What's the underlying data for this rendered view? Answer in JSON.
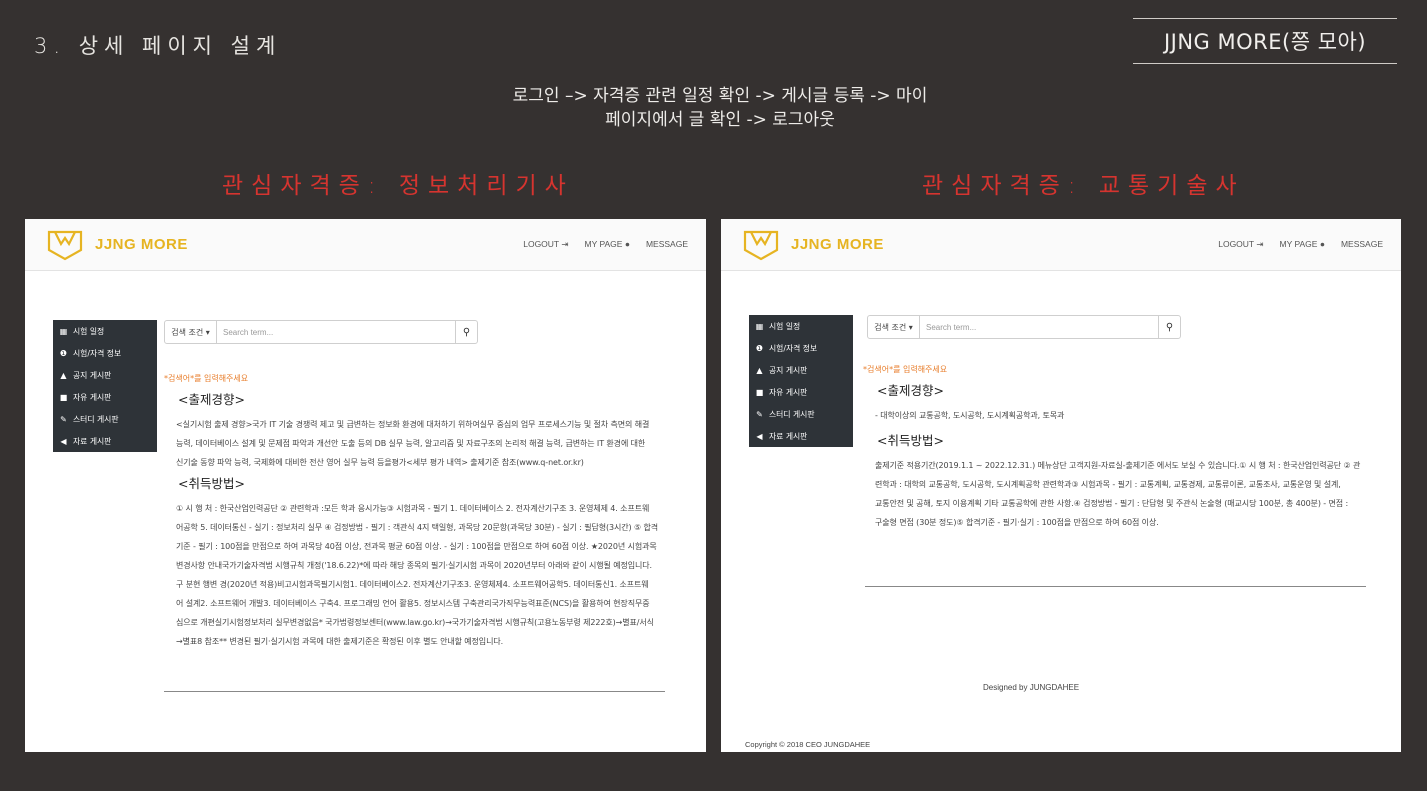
{
  "slide": {
    "title": "3. 상세 페이지 설계",
    "brand": "JJNG MORE(쯩 모아)",
    "flow_line1": "로그인 –> 자격증 관련 일정 확인 -> 게시글 등록 -> 마이",
    "flow_line2": "페이지에서 글 확인 -> 로그아웃",
    "interest_left": "관심자격증: 정보처리기사",
    "interest_right": "관심자격증: 교통기술사",
    "accent_color": "#d6342f"
  },
  "app": {
    "logo_text": "JJNG MORE",
    "nav": {
      "logout": "LOGOUT",
      "mypage": "MY PAGE",
      "message": "MESSAGE"
    },
    "sidebar": [
      {
        "icon": "calendar-icon",
        "label": "시험 일정"
      },
      {
        "icon": "info-icon",
        "label": "시험/자격 정보"
      },
      {
        "icon": "bell-icon",
        "label": "공지 게시판"
      },
      {
        "icon": "comment-icon",
        "label": "자유 게시판"
      },
      {
        "icon": "pencil-icon",
        "label": "스터디 게시판"
      },
      {
        "icon": "share-icon",
        "label": "자료 게시판"
      }
    ],
    "search": {
      "condition": "검색 조건 ▾",
      "placeholder": "Search term..."
    },
    "hint": "*검색어*를 입력해주세요",
    "section1": "<출제경향>",
    "section2": "<취득방법>"
  },
  "left_page": {
    "para1": [
      "<실기시험 출제 경향>국가 IT 기술 경쟁력 제고 및 급변하는 정보화 환경에 대처하기 위하여실무 중심의 업무 프로세스기능 및 절차 측면의 해결",
      "능력, 데이터베이스 설계 및 문제점 파악과 개선안 도출 등의 DB 실무 능력, 알고리즘 및 자료구조의 논리적 해결 능력, 급변하는 IT 환경에 대한",
      "신기술 동향 파악 능력, 국제화에 대비한 전산 영어 실무 능력 등을평가<세부 평가 내역> 출제기준 참조(www.q-net.or.kr)"
    ],
    "para2": [
      "① 시 행 처 : 한국산업인력공단 ② 관련학과 :모든 학과 응시가능③ 시험과목 - 필기 1. 데이터베이스 2. 전자계산기구조 3. 운영체제 4. 소프트웨",
      "어공학 5. 데이터통신 - 실기 : 정보처리 실무 ④ 검정방법 - 필기 : 객관식 4지 택일형, 과목당 20문항(과목당 30분) - 실기 : 필답형(3시간) ⑤ 합격",
      "기준 - 필기 : 100점을 만점으로 하여 과목당 40점 이상, 전과목 평균 60점 이상. - 실기 : 100점을 만점으로 하여 60점 이상. ★2020년 시험과목",
      "변경사항 안내국가기술자격법 시행규칙 개정('18.6.22)*에 따라 해당 종목의 필기·실기시험 과목이 2020년부터 아래와 같이 시행될 예정입니다.",
      "구 분현 행변 경(2020년 적용)비고시험과목필기시험1. 데이터베이스2. 전자계산기구조3. 운영체제4. 소프트웨어공학5. 데이터통신1. 소프트웨",
      "어 설계2. 소프트웨어 개발3. 데이터베이스 구축4. 프로그래밍 언어 활용5. 정보시스템 구축관리국가직무능력표준(NCS)을 활용하여 현장직무중",
      "심으로 개편실기시험정보처리 실무변경없음* 국가법령정보센터(www.law.go.kr)→국가기술자격법 시행규칙(고용노동부령 제222호)→별표/서식",
      "→별표8 참조** 변경된 필기·실기시험 과목에 대한 출제기준은 확정된 이후 별도 안내할 예정입니다."
    ]
  },
  "right_page": {
    "para1": [
      "- 대학이상의 교통공학, 도시공학, 도시계획공학과, 토목과"
    ],
    "para2": [
      "출제기준 적용기간(2019.1.1 ~ 2022.12.31.) 메뉴상단 고객지원-자료실-출제기준 에서도 보실 수 있습니다.① 시 행 처 : 한국산업인력공단 ② 관",
      "련학과 : 대학의 교통공학, 도시공학, 도시계획공학 관련학과③ 시험과목 - 필기 : 교통계획, 교통경제, 교통류이론, 교통조사, 교통운영 및 설계,",
      "교통안전 및 공해, 토지 이용계획 기타 교통공학에 관한 사항.④ 검정방법 - 필기 : 단답형 및 주관식 논술형 (매교시당 100분, 총 400분) - 면접 :",
      "구술형 면접 (30분 정도)⑤ 합격기준 - 필기·실기 : 100점을 만점으로 하여 60점 이상."
    ],
    "designed_by": "Designed by JUNGDAHEE",
    "copyright": "Copyright © 2018 CEO JUNGDAHEE"
  }
}
